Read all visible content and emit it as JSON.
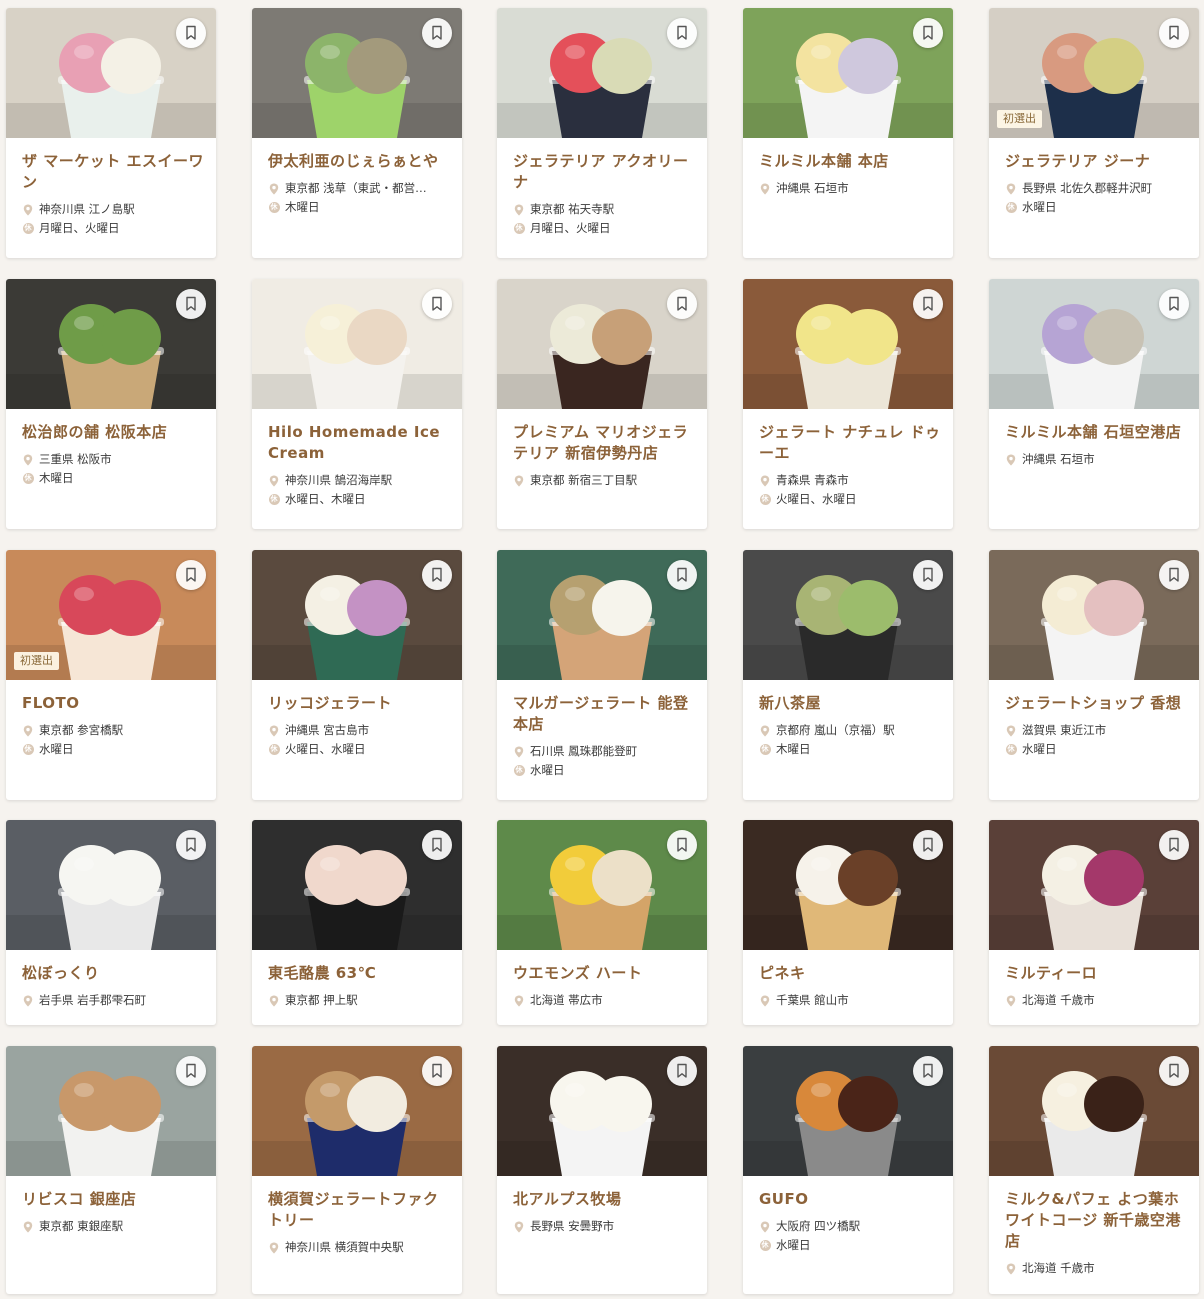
{
  "colors": {
    "accent": "#8c6239",
    "background": "#f6f3ef",
    "card": "#ffffff",
    "pin": "#d9c8b6"
  },
  "closed_icon_glyph": "休",
  "cards": [
    {
      "name": "ザ マーケット エスイーワン",
      "location": "神奈川県 江ノ島駅",
      "closed": "月曜日、火曜日",
      "badge": "",
      "photo_bg": "#d8d2c6",
      "scoops": [
        "#e8a0b4",
        "#f4f1e6"
      ],
      "cup": "#e9f0ec"
    },
    {
      "name": "伊太利亜のじぇらぁとや",
      "location": "東京都 浅草（東武・都営…",
      "closed": "木曜日",
      "badge": "",
      "photo_bg": "#7d7a74",
      "scoops": [
        "#8cb46a",
        "#a39a7c"
      ],
      "cup": "#9ed36a"
    },
    {
      "name": "ジェラテリア アクオリーナ",
      "location": "東京都 祐天寺駅",
      "closed": "月曜日、火曜日",
      "badge": "",
      "photo_bg": "#d9dcd4",
      "scoops": [
        "#e4505a",
        "#d9dbb6"
      ],
      "cup": "#2a2f3e"
    },
    {
      "name": "ミルミル本舗 本店",
      "location": "沖縄県 石垣市",
      "closed": "",
      "badge": "",
      "photo_bg": "#7ea35a",
      "scoops": [
        "#f3e3a0",
        "#cfc8dd"
      ],
      "cup": "#f4f4f4"
    },
    {
      "name": "ジェラテリア ジーナ",
      "location": "長野県 北佐久郡軽井沢町",
      "closed": "水曜日",
      "badge": "初選出",
      "photo_bg": "#d5cfc5",
      "scoops": [
        "#d89a80",
        "#d4cf84"
      ],
      "cup": "#1d2f4a"
    },
    {
      "name": "松治郎の舗 松阪本店",
      "location": "三重県 松阪市",
      "closed": "木曜日",
      "badge": "",
      "photo_bg": "#3b3a36",
      "scoops": [
        "#6f9c48",
        "#6f9c48"
      ],
      "cup": "#c9a878"
    },
    {
      "name": "Hilo Homemade Ice Cream",
      "location": "神奈川県 鵠沼海岸駅",
      "closed": "水曜日、木曜日",
      "badge": "",
      "photo_bg": "#f0ece4",
      "scoops": [
        "#f6f0d8",
        "#ead8c4"
      ],
      "cup": "#f4f2ee"
    },
    {
      "name": "プレミアム マリオジェラテリア 新宿伊勢丹店",
      "location": "東京都 新宿三丁目駅",
      "closed": "",
      "badge": "",
      "photo_bg": "#d9d4ca",
      "scoops": [
        "#ecead8",
        "#c7a078"
      ],
      "cup": "#3a2620"
    },
    {
      "name": "ジェラート ナチュレ ドゥーエ",
      "location": "青森県 青森市",
      "closed": "火曜日、水曜日",
      "badge": "",
      "photo_bg": "#8a5a3a",
      "scoops": [
        "#f1e58a",
        "#f1e58a"
      ],
      "cup": "#ece6d8"
    },
    {
      "name": "ミルミル本舗 石垣空港店",
      "location": "沖縄県 石垣市",
      "closed": "",
      "badge": "",
      "photo_bg": "#cfd6d4",
      "scoops": [
        "#b6a4d4",
        "#c8c2b4"
      ],
      "cup": "#f4f4f4"
    },
    {
      "name": "FLOTO",
      "location": "東京都 参宮橋駅",
      "closed": "水曜日",
      "badge": "初選出",
      "photo_bg": "#c88a5a",
      "scoops": [
        "#d8485a",
        "#d8485a"
      ],
      "cup": "#f6e6d6"
    },
    {
      "name": "リッコジェラート",
      "location": "沖縄県 宮古島市",
      "closed": "火曜日、水曜日",
      "badge": "",
      "photo_bg": "#5a4a3e",
      "scoops": [
        "#f4f0e4",
        "#c492c4"
      ],
      "cup": "#2f6a54"
    },
    {
      "name": "マルガージェラート 能登本店",
      "location": "石川県 鳳珠郡能登町",
      "closed": "水曜日",
      "badge": "",
      "photo_bg": "#3f6a58",
      "scoops": [
        "#b6a070",
        "#f6f4ec"
      ],
      "cup": "#d4a478"
    },
    {
      "name": "新八茶屋",
      "location": "京都府 嵐山（京福）駅",
      "closed": "木曜日",
      "badge": "",
      "photo_bg": "#4a4a4a",
      "scoops": [
        "#a8b474",
        "#9cbc6c"
      ],
      "cup": "#2a2a2a"
    },
    {
      "name": "ジェラートショップ 香想",
      "location": "滋賀県 東近江市",
      "closed": "水曜日",
      "badge": "",
      "photo_bg": "#7a6a5a",
      "scoops": [
        "#f4ecd4",
        "#e4c0c0"
      ],
      "cup": "#f4f4f4"
    },
    {
      "name": "松ぼっくり",
      "location": "岩手県 岩手郡雫石町",
      "closed": "",
      "badge": "",
      "photo_bg": "#5a5e64",
      "scoops": [
        "#f6f6f2",
        "#f6f6f2"
      ],
      "cup": "#e8e8e8"
    },
    {
      "name": "東毛酪農 63℃",
      "location": "東京都 押上駅",
      "closed": "",
      "badge": "",
      "photo_bg": "#2e2e2e",
      "scoops": [
        "#f0d8cc",
        "#f0d8cc"
      ],
      "cup": "#1a1a1a"
    },
    {
      "name": "ウエモンズ ハート",
      "location": "北海道 帯広市",
      "closed": "",
      "badge": "",
      "photo_bg": "#5e8a4a",
      "scoops": [
        "#f2cc3a",
        "#ece0c8"
      ],
      "cup": "#d4a468"
    },
    {
      "name": "ピネキ",
      "location": "千葉県 館山市",
      "closed": "",
      "badge": "",
      "photo_bg": "#3a2a22",
      "scoops": [
        "#f6f2ea",
        "#6a4028"
      ],
      "cup": "#e0b878"
    },
    {
      "name": "ミルティーロ",
      "location": "北海道 千歳市",
      "closed": "",
      "badge": "",
      "photo_bg": "#5a4038",
      "scoops": [
        "#f4f0e4",
        "#a4386a"
      ],
      "cup": "#e8e0d8"
    },
    {
      "name": "リビスコ 銀座店",
      "location": "東京都 東銀座駅",
      "closed": "",
      "badge": "",
      "photo_bg": "#9aa4a0",
      "scoops": [
        "#c8986a",
        "#c8986a"
      ],
      "cup": "#f2f2f0"
    },
    {
      "name": "横須賀ジェラートファクトリー",
      "location": "神奈川県 横須賀中央駅",
      "closed": "",
      "badge": "",
      "photo_bg": "#9a6a44",
      "scoops": [
        "#c49a6a",
        "#f2ece0"
      ],
      "cup": "#1e2c6a"
    },
    {
      "name": "北アルプス牧場",
      "location": "長野県 安曇野市",
      "closed": "",
      "badge": "",
      "photo_bg": "#3a2e28",
      "scoops": [
        "#f8f6ee",
        "#f8f6ee"
      ],
      "cup": "#f4f4f4"
    },
    {
      "name": "GUFO",
      "location": "大阪府 四ツ橋駅",
      "closed": "水曜日",
      "badge": "",
      "photo_bg": "#3a3e40",
      "scoops": [
        "#d8883a",
        "#4a2418"
      ],
      "cup": "#8a8a8a"
    },
    {
      "name": "ミルク&パフェ よつ葉ホワイトコージ 新千歳空港店",
      "location": "北海道 千歳市",
      "closed": "",
      "badge": "",
      "photo_bg": "#6a4a36",
      "scoops": [
        "#f6f0e0",
        "#3a2218"
      ],
      "cup": "#eaeaea"
    }
  ]
}
